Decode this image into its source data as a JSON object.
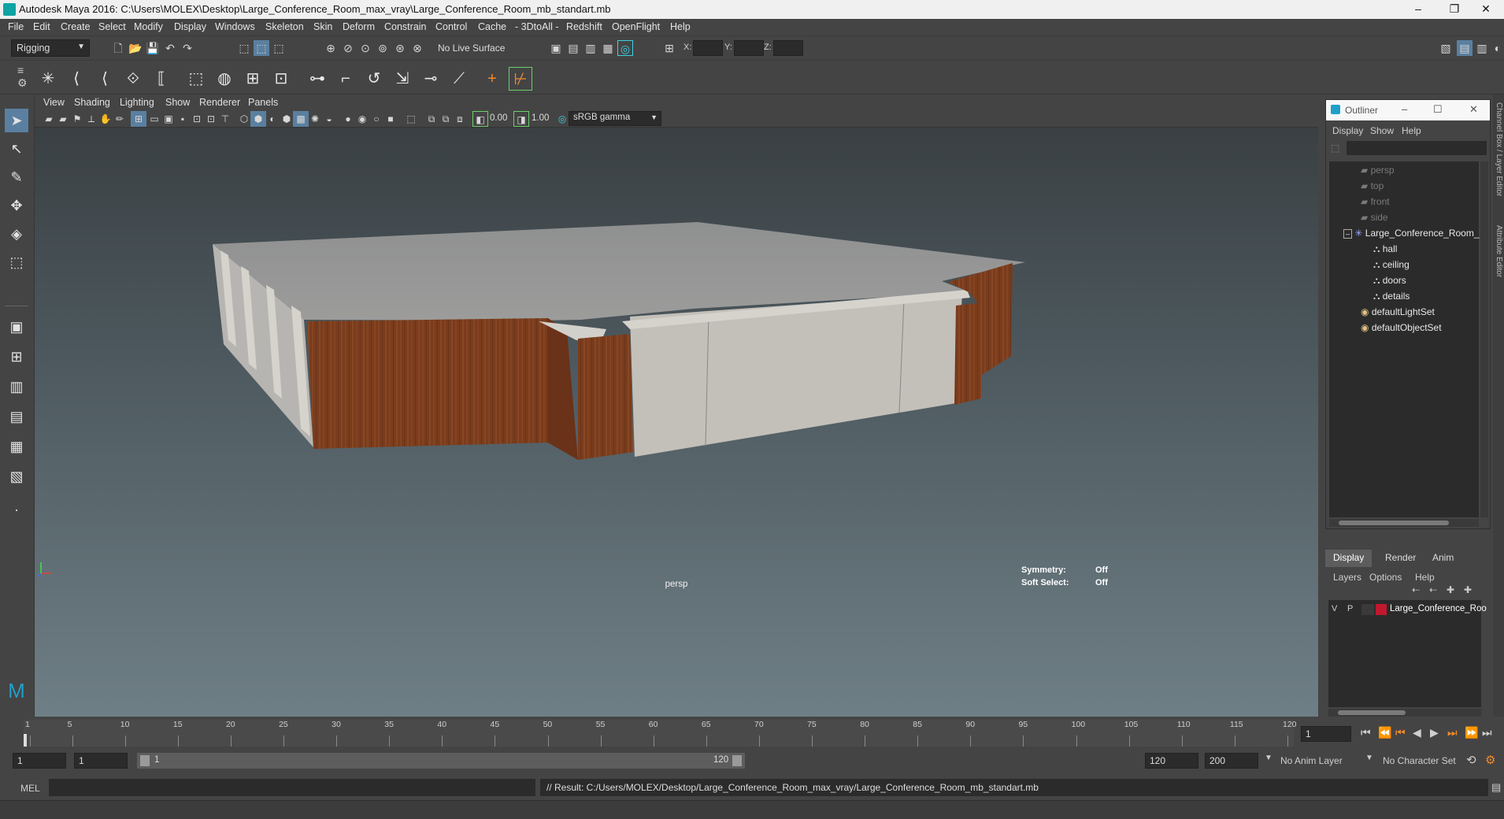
{
  "window": {
    "title": "Autodesk Maya 2016: C:\\Users\\MOLEX\\Desktop\\Large_Conference_Room_max_vray\\Large_Conference_Room_mb_standart.mb",
    "minimize": "–",
    "restore": "❐",
    "close": "✕"
  },
  "menu": [
    "File",
    "Edit",
    "Create",
    "Select",
    "Modify",
    "Display",
    "Windows",
    "Skeleton",
    "Skin",
    "Deform",
    "Constrain",
    "Control",
    "Cache",
    "- 3DtoAll -",
    "Redshift",
    "OpenFlight",
    "Help"
  ],
  "status_line": {
    "menu_set": "Rigging",
    "live_surface": "No Live Surface",
    "x_label": "X:",
    "y_label": "Y:",
    "z_label": "Z:"
  },
  "viewport": {
    "menu": [
      "View",
      "Shading",
      "Lighting",
      "Show",
      "Renderer",
      "Panels"
    ],
    "exposure": "0.00",
    "gamma": "1.00",
    "color_space": "sRGB gamma",
    "camera_label": "persp",
    "symmetry_label": "Symmetry:",
    "symmetry_value": "Off",
    "soft_select_label": "Soft Select:",
    "soft_select_value": "Off"
  },
  "outliner": {
    "title": "Outliner",
    "menu": [
      "Display",
      "Show",
      "Help"
    ],
    "items": [
      {
        "label": "persp",
        "icon": "camera-icon",
        "dim": true
      },
      {
        "label": "top",
        "icon": "camera-icon",
        "dim": true
      },
      {
        "label": "front",
        "icon": "camera-icon",
        "dim": true
      },
      {
        "label": "side",
        "icon": "camera-icon",
        "dim": true
      },
      {
        "label": "Large_Conference_Room_",
        "icon": "group-icon",
        "dim": false
      },
      {
        "label": "hall",
        "icon": "mesh-group-icon",
        "dim": false
      },
      {
        "label": "ceiling",
        "icon": "mesh-group-icon",
        "dim": false
      },
      {
        "label": "doors",
        "icon": "mesh-group-icon",
        "dim": false
      },
      {
        "label": "details",
        "icon": "mesh-group-icon",
        "dim": false
      },
      {
        "label": "defaultLightSet",
        "icon": "set-icon",
        "dim": false
      },
      {
        "label": "defaultObjectSet",
        "icon": "set-icon",
        "dim": false
      }
    ]
  },
  "layer_editor": {
    "tabs": [
      "Display",
      "Render",
      "Anim"
    ],
    "menu": [
      "Layers",
      "Options",
      "Help"
    ],
    "layer": {
      "v": "V",
      "p": "P",
      "name": "Large_Conference_Roo",
      "color": "#c0182f"
    }
  },
  "side_labels": [
    "Channel Box / Layer Editor",
    "Attribute Editor"
  ],
  "timeline": {
    "ticks": [
      "1",
      "5",
      "10",
      "15",
      "20",
      "25",
      "30",
      "35",
      "40",
      "45",
      "50",
      "55",
      "60",
      "65",
      "70",
      "75",
      "80",
      "85",
      "90",
      "95",
      "100",
      "105",
      "110",
      "115",
      "120"
    ],
    "current_frame": "1"
  },
  "range": {
    "start": "1",
    "playback_start": "1",
    "slider_start": "1",
    "slider_end": "120",
    "playback_end": "120",
    "end": "200",
    "anim_layer": "No Anim Layer",
    "character_set": "No Character Set"
  },
  "command_line": {
    "label": "MEL",
    "result": "// Result: C:/Users/MOLEX/Desktop/Large_Conference_Room_max_vray/Large_Conference_Room_mb_standart.mb"
  },
  "colors": {
    "accent": "#1fa0c8",
    "maya_teal": "#0fa3a3",
    "wood": "#7a3c1c"
  }
}
